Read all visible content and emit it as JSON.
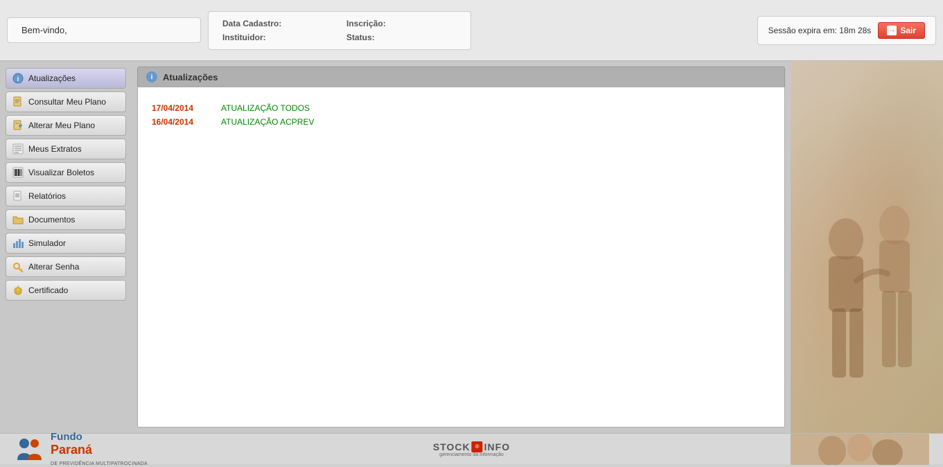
{
  "header": {
    "welcome_label": "Bem-vindo,",
    "data_cadastro_label": "Data Cadastro:",
    "inscricao_label": "Inscrição:",
    "instituidor_label": "Instituidor:",
    "status_label": "Status:",
    "session_text": "Sessão expira em: 18m 28s",
    "sair_label": "Sair"
  },
  "page_title": "Atualizações",
  "sidebar": {
    "items": [
      {
        "id": "atualizacoes",
        "label": "Atualizações",
        "icon": "info-icon",
        "active": true
      },
      {
        "id": "consultar-meu-plano",
        "label": "Consultar Meu Plano",
        "icon": "document-icon",
        "active": false
      },
      {
        "id": "alterar-meu-plano",
        "label": "Alterar Meu Plano",
        "icon": "edit-icon",
        "active": false
      },
      {
        "id": "meus-extratos",
        "label": "Meus Extratos",
        "icon": "list-icon",
        "active": false
      },
      {
        "id": "visualizar-boletos",
        "label": "Visualizar Boletos",
        "icon": "barcode-icon",
        "active": false
      },
      {
        "id": "relatorios",
        "label": "Relatórios",
        "icon": "report-icon",
        "active": false
      },
      {
        "id": "documentos",
        "label": "Documentos",
        "icon": "folder-icon",
        "active": false
      },
      {
        "id": "simulador",
        "label": "Simulador",
        "icon": "chart-icon",
        "active": false
      },
      {
        "id": "alterar-senha",
        "label": "Alterar Senha",
        "icon": "key-icon",
        "active": false
      },
      {
        "id": "certificado",
        "label": "Certificado",
        "icon": "medal-icon",
        "active": false
      }
    ]
  },
  "updates": [
    {
      "date": "17/04/2014",
      "text": "ATUALIZAÇÃO TODOS"
    },
    {
      "date": "16/04/2014",
      "text": "ATUALIZAÇÃO ACPREV"
    }
  ],
  "footer": {
    "brand_fundo": "Fundo",
    "brand_parana": "Paraná",
    "brand_sub": "DE PREVIDÊNCIA MULTIPATROCINADA",
    "stock_label": "STOCK",
    "info_label": "INFO",
    "stock_sub": "gerenciamento da informação"
  }
}
